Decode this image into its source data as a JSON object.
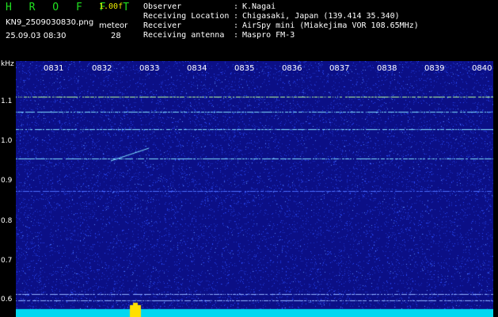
{
  "header": {
    "app_name": "H R O F F T",
    "version": "1.00f",
    "filename": "KN9_2509030830.png",
    "datetime": "25.09.03 08:30",
    "meteor_label": "meteor",
    "meteor_count": "28"
  },
  "info": [
    {
      "label": "Observer",
      "value": "K.Nagai"
    },
    {
      "label": "Receiving Location",
      "value": "Chigasaki, Japan (139.414 35.340)"
    },
    {
      "label": "Receiver",
      "value": "AirSpy mini (Miakejima VOR 108.65MHz)"
    },
    {
      "label": "Receiving antenna",
      "value": "Maspro FM-3"
    }
  ],
  "axis": {
    "y_unit": "kHz",
    "y_ticks": [
      "1.1",
      "1.0",
      "0.9",
      "0.8",
      "0.7",
      "0.6"
    ],
    "x_ticks": [
      "0831",
      "0832",
      "0833",
      "0834",
      "0835",
      "0836",
      "0837",
      "0838",
      "0839",
      "0840"
    ]
  },
  "colors": {
    "background": "#0b0f86",
    "noise": "#2a4cff",
    "signal": "#7fe0ff",
    "bottom_band": "#00d8f0",
    "burst": "#ffe000"
  }
}
